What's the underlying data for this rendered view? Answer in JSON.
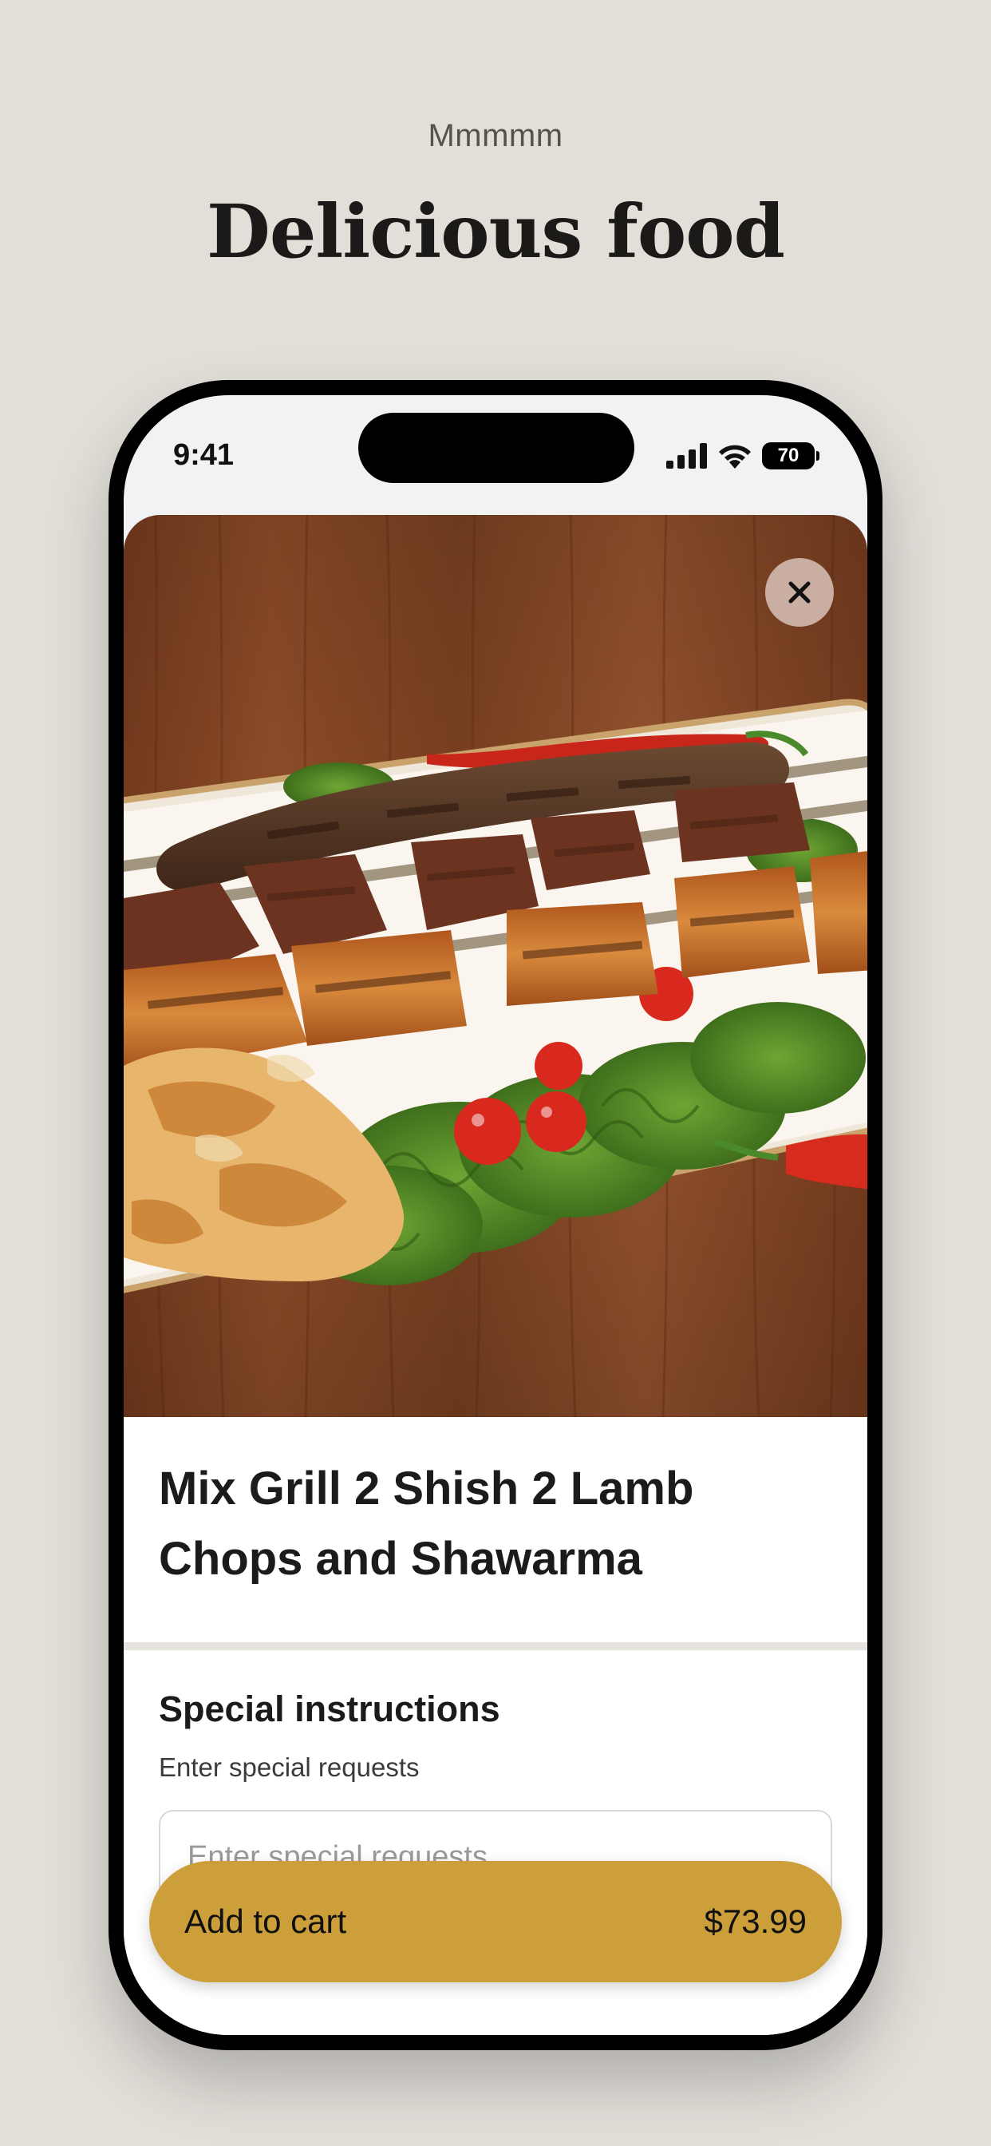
{
  "header": {
    "eyebrow": "Mmmmm",
    "headline": "Delicious food"
  },
  "status_bar": {
    "time": "9:41",
    "battery_level": "70"
  },
  "item": {
    "title": "Mix Grill 2 Shish 2 Lamb Chops and Shawarma"
  },
  "special_instructions": {
    "title": "Special instructions",
    "subtitle": "Enter special requests",
    "placeholder": "Enter special requests",
    "value": ""
  },
  "cart": {
    "label": "Add to cart",
    "price": "$73.99"
  },
  "icons": {
    "close": "close-icon",
    "signal": "cellular-signal-icon",
    "wifi": "wifi-icon",
    "battery": "battery-icon"
  },
  "colors": {
    "background": "#e2dfd9",
    "accent": "#cc9f3b",
    "wood": "#8a4a28"
  }
}
